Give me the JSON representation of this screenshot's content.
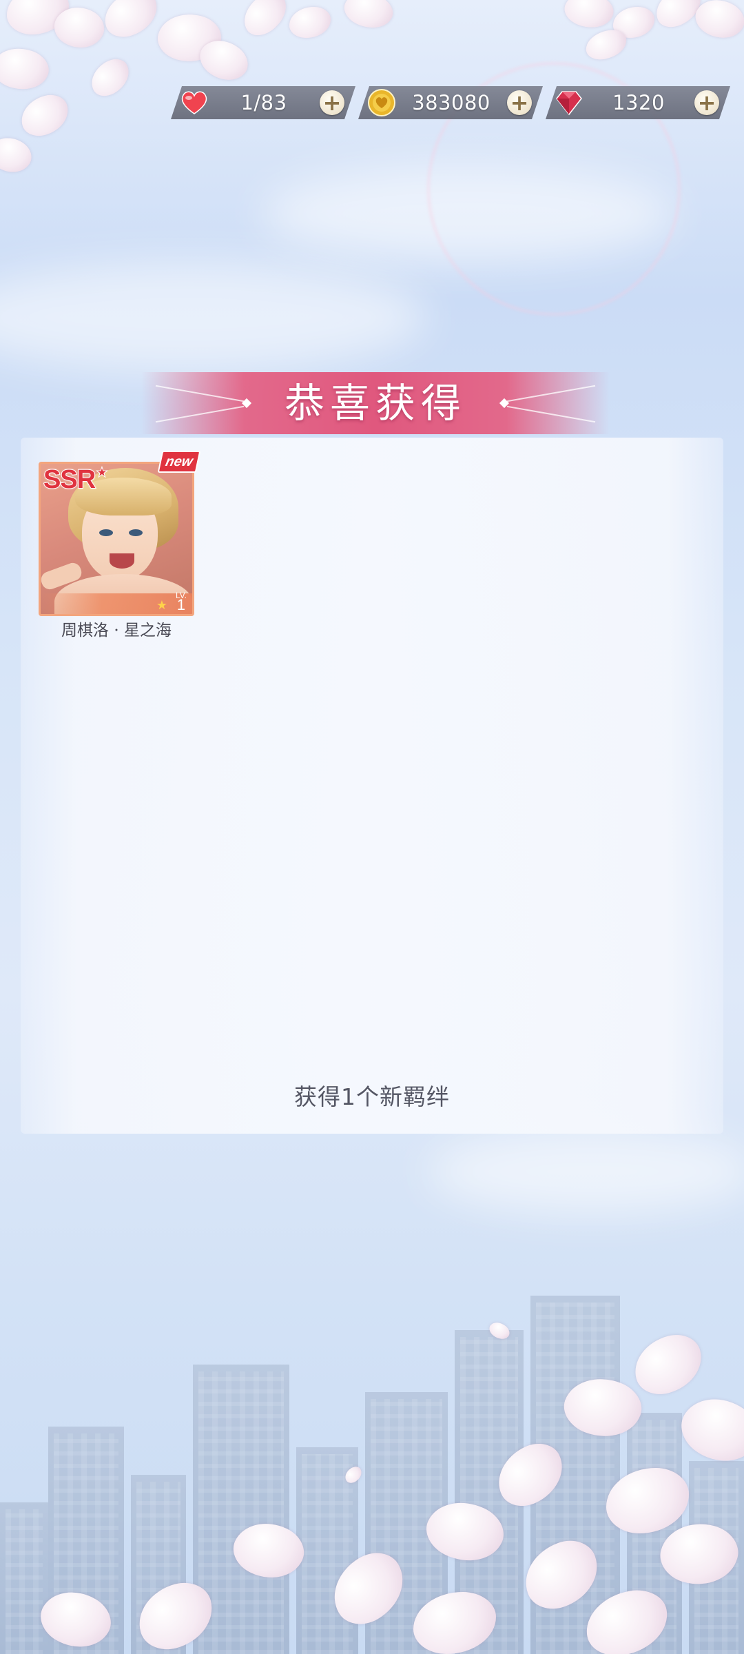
{
  "resources": {
    "stamina": {
      "icon": "heart-icon",
      "value": "1/83",
      "color": "#f0434f"
    },
    "coins": {
      "icon": "coin-icon",
      "value": "383080",
      "color": "#e9b62b"
    },
    "gems": {
      "icon": "diamond-icon",
      "value": "1320",
      "color": "#d62f4d"
    },
    "add_symbol": "+"
  },
  "banner": {
    "title": "恭喜获得",
    "color": "#e0587e"
  },
  "reward_card": {
    "rarity": "SSR",
    "rarity_star": "★",
    "new_tag": "new",
    "stars": "★",
    "level_label": "LV.",
    "level": "1",
    "name": "周棋洛 · 星之海",
    "border_color": "#f3a57d"
  },
  "summary": "获得1个新羁绊"
}
